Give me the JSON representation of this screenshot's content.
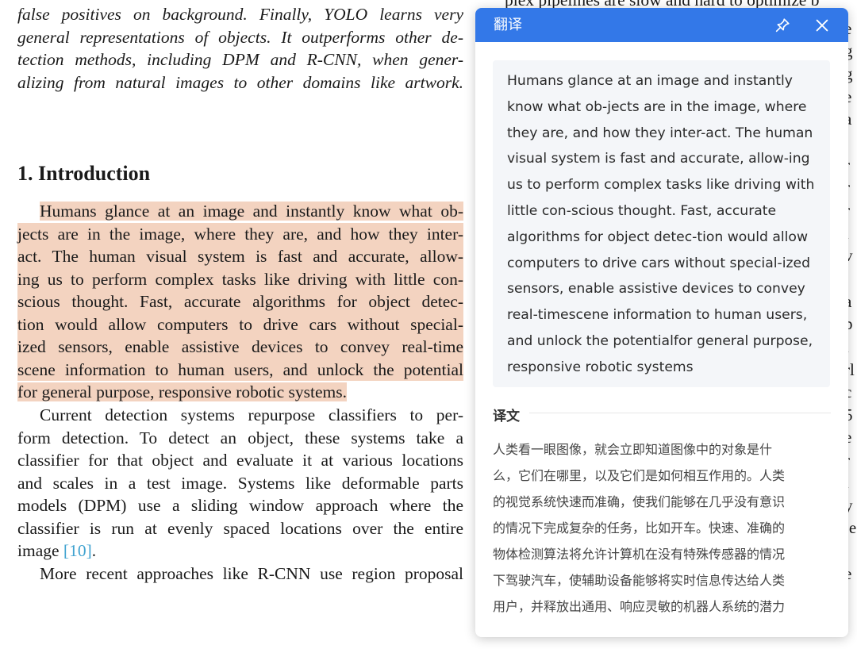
{
  "document": {
    "top_lines": [
      "false positives on background.  Finally, YOLO learns very",
      "general representations of objects. It outperforms other de-",
      "tection methods, including DPM and R-CNN, when gener-",
      "alizing from natural images to other domains like artwork."
    ],
    "heading": "1. Introduction",
    "highlighted_lines": [
      "Humans glance at an image and instantly know what ob-",
      "jects are in the image, where they are, and how they inter-",
      "act.  The human visual system is fast and accurate, allow-",
      "ing us to perform complex tasks like driving with little con-",
      "scious thought.  Fast, accurate algorithms for object detec-",
      "tion would allow computers to drive cars without special-",
      "ized sensors, enable assistive devices to convey real-time",
      "scene information to human users, and unlock the potential",
      "for general purpose, responsive robotic systems."
    ],
    "body_lines": [
      "Current detection systems repurpose classifiers to per-",
      "form detection.  To detect an object, these systems take a",
      "classifier for that object and evaluate it at various locations",
      "and scales in a test image.  Systems like deformable parts",
      "models (DPM) use a sliding window approach where the",
      "classifier is run at evenly spaced locations over the entire"
    ],
    "citation_line_prefix": "image ",
    "citation": "[10]",
    "citation_line_suffix": ".",
    "final_line": "More recent approaches like R-CNN use region proposal",
    "top_right_fragment": "plex pipelines are slow and hard to optimize b",
    "right_edge_fragments": [
      "e",
      "g",
      "g",
      "e",
      "a",
      "r",
      "r",
      "r",
      "i",
      "v",
      "a",
      "p",
      "i",
      "rl",
      "c",
      "5",
      "e",
      "r",
      "i",
      "y",
      "je",
      "e"
    ]
  },
  "panel": {
    "title": "翻译",
    "source_lines": [
      "Humans glance at an image and instantly",
      "know what ob-jects are in the image, where",
      "they are, and how they inter-act. The human",
      "visual system is fast and accurate, allow-ing",
      "us to perform complex tasks like driving with",
      "little con-scious thought. Fast, accurate",
      "algorithms for object detec-tion would allow",
      "computers to drive cars without special-ized",
      "sensors, enable assistive devices to convey",
      "real-timescene information to human users,",
      "and unlock the potentialfor general purpose,",
      "responsive robotic systems"
    ],
    "translation_label": "译文",
    "translation_lines": [
      "人类看一眼图像，就会立即知道图像中的对象是什",
      "么，它们在哪里，以及它们是如何相互作用的。人类",
      "的视觉系统快速而准确，使我们能够在几乎没有意识",
      "的情况下完成复杂的任务，比如开车。快速、准确的",
      "物体检测算法将允许计算机在没有特殊传感器的情况",
      "下驾驶汽车，使辅助设备能够将实时信息传达给人类",
      "用户，并释放出通用、响应灵敏的机器人系统的潜力"
    ],
    "icons": {
      "pin": "pin-icon",
      "close": "close-icon"
    },
    "colors": {
      "header": "#3378e8",
      "highlight": "#f3d3c0",
      "citation": "#41a3d0"
    }
  }
}
